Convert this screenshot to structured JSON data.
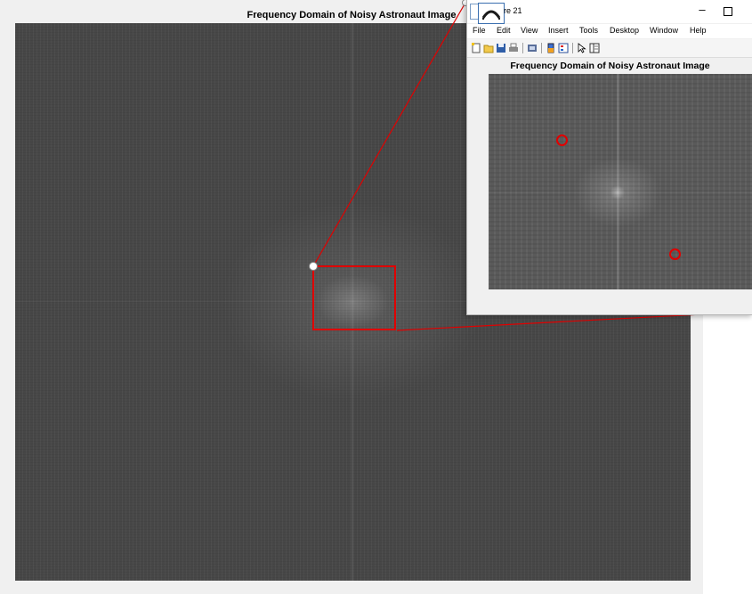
{
  "main_figure": {
    "title": "Frequency Domain of Noisy Astronaut Image"
  },
  "inset_window": {
    "title": "re 21",
    "menu": [
      "File",
      "Edit",
      "View",
      "Insert",
      "Tools",
      "Desktop",
      "Window",
      "Help"
    ],
    "toolbar_icons": [
      "new-figure-icon",
      "open-file-icon",
      "save-icon",
      "print-icon",
      "print-preview-icon",
      "colorbar-icon",
      "legend-icon",
      "pointer-icon",
      "property-editor-icon"
    ],
    "minimize_glyph": "–",
    "plot_title": "Frequency Domain of Noisy Astronaut Image"
  },
  "colors": {
    "zoom_highlight": "#e00000",
    "window_bg": "#f0f0f0",
    "spectrum_gray": "#474747"
  }
}
